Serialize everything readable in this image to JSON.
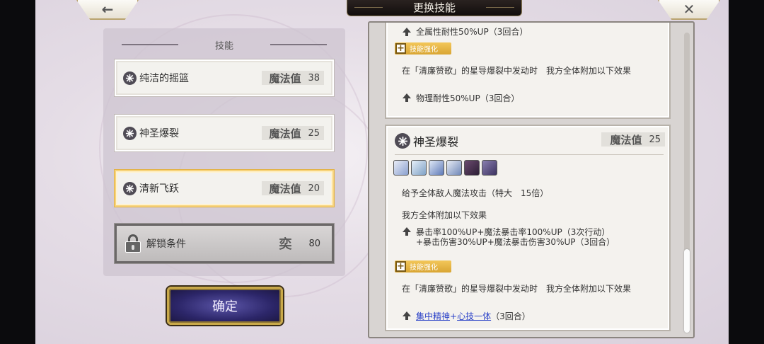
{
  "header": {
    "title": "更换技能",
    "back_icon": "←",
    "close_icon": "✕"
  },
  "left": {
    "section_title": "技能",
    "mp_label": "魔法值",
    "skills": [
      {
        "name": "纯洁的摇篮",
        "mp": "38"
      },
      {
        "name": "神圣爆裂",
        "mp": "25"
      },
      {
        "name": "清新飞跃",
        "mp": "20"
      }
    ],
    "locked": {
      "label": "解锁条件",
      "stamp": "奕",
      "value": "80"
    },
    "confirm_label": "确定"
  },
  "detail": {
    "top_card": {
      "partial_line": "全属性耐性50%UP（3回合）",
      "enhance_tag": "技能强化",
      "enhance_desc": "在「清廉赞歌」的星导爆裂中发动时　我方全体附加以下效果",
      "buff": "物理耐性50%UP（3回合）"
    },
    "main_card": {
      "name": "神圣爆裂",
      "mp_label": "魔法值",
      "mp": "25",
      "effect_icon_names": [
        "wing-icon",
        "spiral-icon",
        "bird-icon",
        "flame-icon",
        "portrait-icon",
        "wave-icon"
      ],
      "desc1": "给予全体敌人魔法攻击（特大　15倍）",
      "desc2": "我方全体附加以下效果",
      "buff_line1": "暴击率100%UP+魔法暴击率100%UP（3次行动）",
      "buff_line2": "+暴击伤害30%UP+魔法暴击伤害30%UP（3回合）",
      "enhance_tag": "技能强化",
      "enhance_desc": "在「清廉赞歌」的星导爆裂中发动时　我方全体附加以下效果",
      "link1": "集中精神",
      "link_plus": "+",
      "link2": "心技一体",
      "link_suffix": "（3回合）"
    }
  },
  "colors": {
    "accent_gold": "#e2b246",
    "confirm_purple": "#2c2669",
    "link_blue": "#2b42c8"
  }
}
